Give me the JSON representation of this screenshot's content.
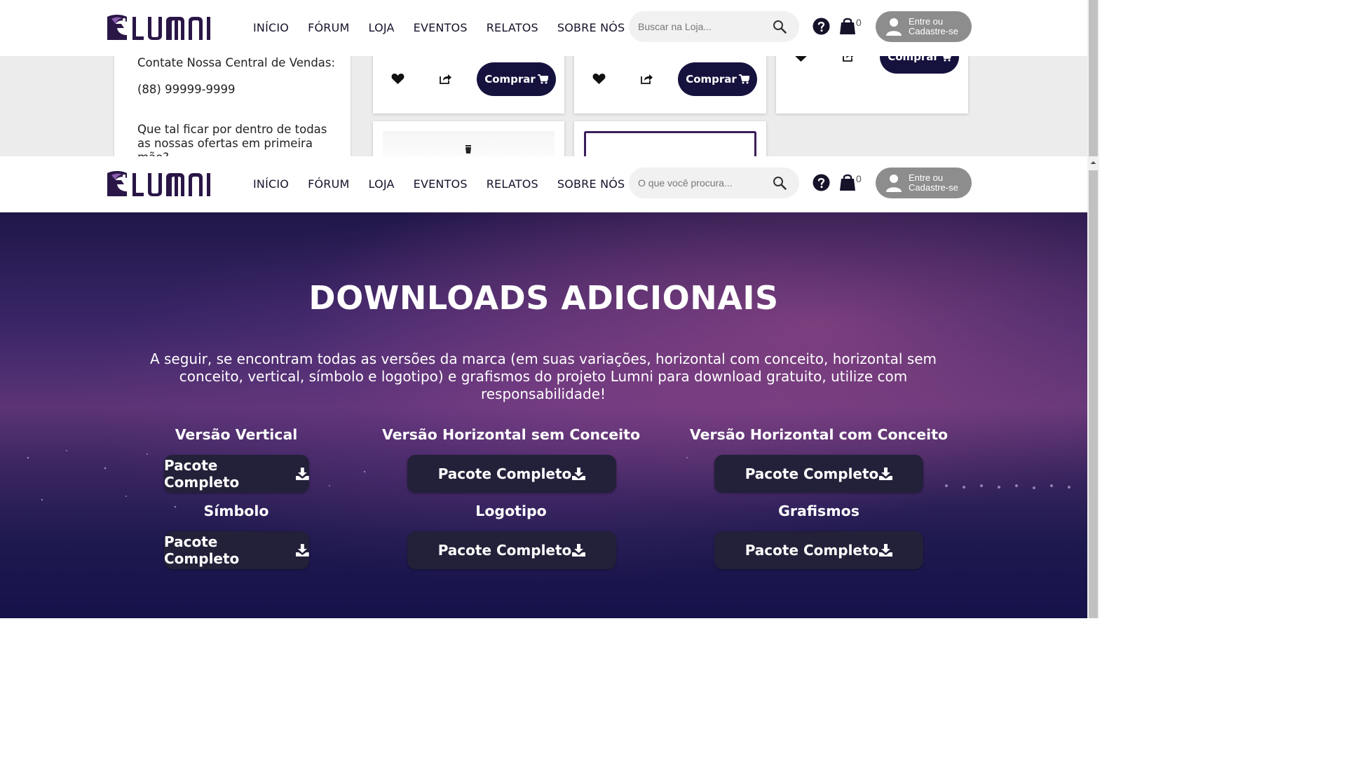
{
  "header": {
    "nav": [
      "INÍCIO",
      "FÓRUM",
      "LOJA",
      "EVENTOS",
      "RELATOS",
      "SOBRE NÓS"
    ],
    "search_placeholder_shop": "Buscar na Loja...",
    "search_placeholder_main": "O que você procura...",
    "cart_count": "0",
    "login_label_line1": "Entre ou",
    "login_label_line2": "Cadastre-se"
  },
  "shop": {
    "sidebar_contact": "Contate Nossa Central de Vendas:",
    "sidebar_phone": "(88) 99999-9999",
    "sidebar_promo": "Que tal ficar por dentro de todas as nossas ofertas em primeira mão?",
    "buy_label": "Comprar"
  },
  "hero": {
    "title": "DOWNLOADS ADICIONAIS",
    "description": "A seguir, se encontram todas as versões da marca (em suas variações, horizontal com conceito, horizontal sem conceito, vertical, símbolo e logotipo) e grafismos do projeto Lumni para download gratuito, utilize com responsabilidade!",
    "downloads": [
      {
        "title": "Versão Vertical",
        "button": "Pacote Completo"
      },
      {
        "title": "Versão Horizontal sem Conceito",
        "button": "Pacote Completo"
      },
      {
        "title": "Versão Horizontal com Conceito",
        "button": "Pacote Completo"
      },
      {
        "title": "Símbolo",
        "button": "Pacote Completo"
      },
      {
        "title": "Logotipo",
        "button": "Pacote Completo"
      },
      {
        "title": "Grafismos",
        "button": "Pacote Completo"
      }
    ]
  },
  "colors": {
    "brand_dark": "#16123e",
    "button_dark": "#232039",
    "login_gray": "#8d8d8d"
  },
  "icons": [
    "lumni-logo",
    "search-icon",
    "help-icon",
    "cart-icon",
    "user-icon",
    "heart-icon",
    "share-icon",
    "cart-small-icon",
    "download-icon"
  ]
}
